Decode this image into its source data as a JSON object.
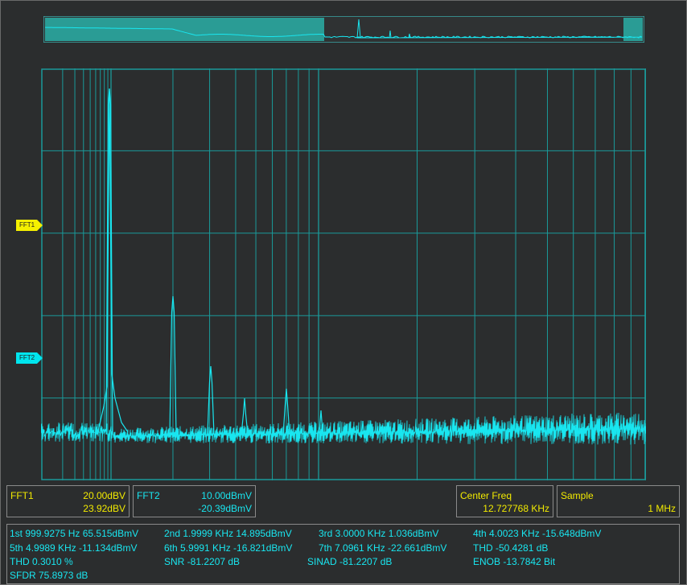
{
  "markers": {
    "fft1": "FFT1",
    "fft2": "FFT2"
  },
  "channels": {
    "fft1": {
      "label": "FFT1",
      "scale": "20.00dBV",
      "offset": "23.92dBV"
    },
    "fft2": {
      "label": "FFT2",
      "scale": "10.00dBmV",
      "offset": "-20.39dBmV"
    }
  },
  "center_freq": {
    "label": "Center Freq",
    "value": "12.727768 KHz"
  },
  "sample": {
    "label": "Sample",
    "value": "1 MHz"
  },
  "measurements": {
    "r1": [
      "1st 999.9275 Hz  65.515dBmV",
      "2nd 1.9999 KHz  14.895dBmV",
      "3rd 3.0000 KHz  1.036dBmV",
      "4th 4.0023 KHz  -15.648dBmV"
    ],
    "r2": [
      "5th 4.9989 KHz  -11.134dBmV",
      "6th 5.9991 KHz  -16.821dBmV",
      "7th 7.0961 KHz  -22.661dBmV",
      "THD  -50.4281 dB"
    ],
    "r3": [
      "THD  0.3010 %",
      "SNR  -81.2207 dB",
      "SINAD  -81.2207 dB",
      "ENOB  -13.7842 Bit"
    ],
    "r4": [
      "SFDR  75.8973 dB"
    ]
  },
  "chart_data": {
    "type": "line",
    "x_scale": "log",
    "y_scale": "linear",
    "grid": true,
    "legend": "none",
    "harmonics": [
      {
        "order": 1,
        "freq_hz": 999.9275,
        "level_dbmv": 65.515
      },
      {
        "order": 2,
        "freq_hz": 1999.9,
        "level_dbmv": 14.895
      },
      {
        "order": 3,
        "freq_hz": 3000.0,
        "level_dbmv": 1.036
      },
      {
        "order": 4,
        "freq_hz": 4002.3,
        "level_dbmv": -15.648
      },
      {
        "order": 5,
        "freq_hz": 4998.9,
        "level_dbmv": -11.134
      },
      {
        "order": 6,
        "freq_hz": 5999.1,
        "level_dbmv": -16.821
      },
      {
        "order": 7,
        "freq_hz": 7096.1,
        "level_dbmv": -22.661
      }
    ],
    "series_color": "#19e6f0"
  },
  "colors": {
    "background": "#2b2d2e",
    "grid": "#1a9a9a",
    "trace": "#19e6f0",
    "fft1_accent": "#f2ea00",
    "fft2_accent": "#19e6f0"
  }
}
